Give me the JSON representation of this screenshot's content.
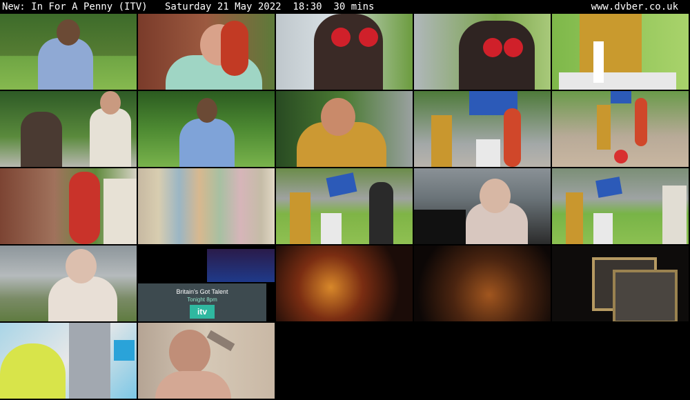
{
  "header": {
    "title": "New: In For A Penny (ITV)   Saturday 21 May 2022  18:30  30 mins",
    "site": "www.dvber.co.uk"
  },
  "thumbnails": [
    {
      "description": "man in blue shirt in park"
    },
    {
      "description": "woman with red hair adjusting glasses"
    },
    {
      "description": "woman wearing googly-eye goggles"
    },
    {
      "description": "woman wearing googly-eye goggles, close-up"
    },
    {
      "description": "presenter in gold jacket at pedestal"
    },
    {
      "description": "woman and man by trees"
    },
    {
      "description": "man in blue shirt on grass"
    },
    {
      "description": "presenter in gold sequin jacket"
    },
    {
      "description": "presenter with hot dog costume and sign"
    },
    {
      "description": "presenter and hot dog costume on terrace"
    },
    {
      "description": "hot dog costume walking"
    },
    {
      "description": "blurred colour transition"
    },
    {
      "description": "presenter at pedestal with sign"
    },
    {
      "description": "older woman looking up"
    },
    {
      "description": "presenter with sign on grass"
    },
    {
      "description": "older woman pointing"
    },
    {
      "description": "end credits with next programme card",
      "promo_text": "Britain's Got Talent",
      "promo_time": "Tonight 8pm",
      "network": "itv"
    },
    {
      "description": "fantasy dragon battle"
    },
    {
      "description": "feast table in dark room"
    },
    {
      "description": "ornate frame on dark background"
    },
    {
      "description": "colourful cartoon blocks"
    },
    {
      "description": "smiling woman holding card"
    }
  ]
}
